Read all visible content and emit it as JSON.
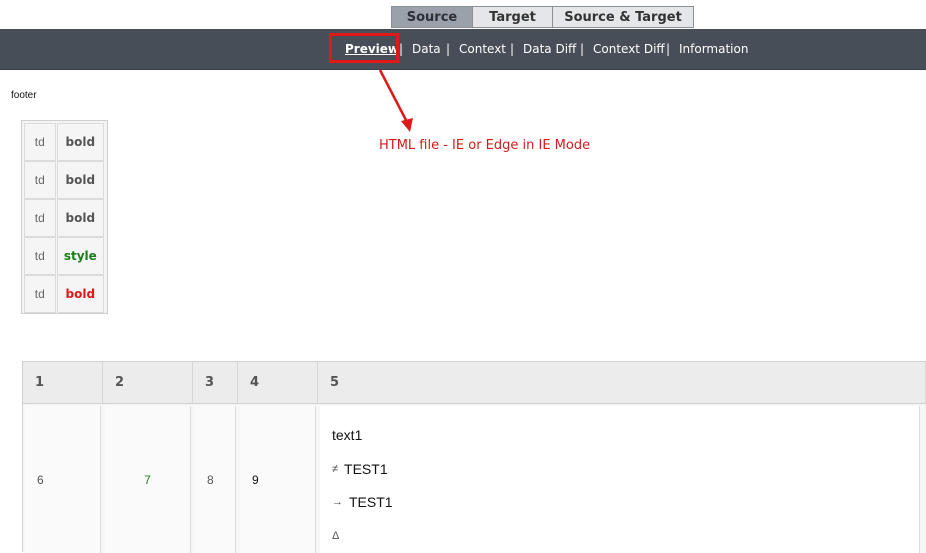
{
  "tabs": [
    {
      "label": "Source",
      "active": true
    },
    {
      "label": "Target",
      "active": false
    },
    {
      "label": "Source & Target",
      "active": false
    }
  ],
  "nav": {
    "items": [
      "Preview",
      "Data",
      "Context",
      "Data Diff",
      "Context Diff",
      "Information"
    ],
    "separator": "|",
    "active": "Preview"
  },
  "annotation": "HTML file - IE or Edge in IE Mode",
  "footer_label": "footer",
  "small_table": {
    "rows": [
      {
        "td": "td",
        "value": "bold",
        "color": "#555555"
      },
      {
        "td": "td",
        "value": "bold",
        "color": "#555555"
      },
      {
        "td": "td",
        "value": "bold",
        "color": "#555555"
      },
      {
        "td": "td",
        "value": "style",
        "color": "#1a7f1a"
      },
      {
        "td": "td",
        "value": "bold",
        "color": "#e01818"
      }
    ]
  },
  "big_table": {
    "headers": [
      "1",
      "2",
      "3",
      "4",
      "5"
    ],
    "row": {
      "c1": "6",
      "c2": "7",
      "c3": "8",
      "c4": "9",
      "c5": {
        "text": "text1",
        "diff_line_symbol": "≠",
        "diff_line_text": "TEST1",
        "arrow_line_symbol": "→",
        "arrow_line_text": "TEST1",
        "delta_symbol": "Δ"
      }
    }
  },
  "colors": {
    "navbar": "#474e57",
    "highlight": "#e01818",
    "annotation": "#d21b1b"
  }
}
